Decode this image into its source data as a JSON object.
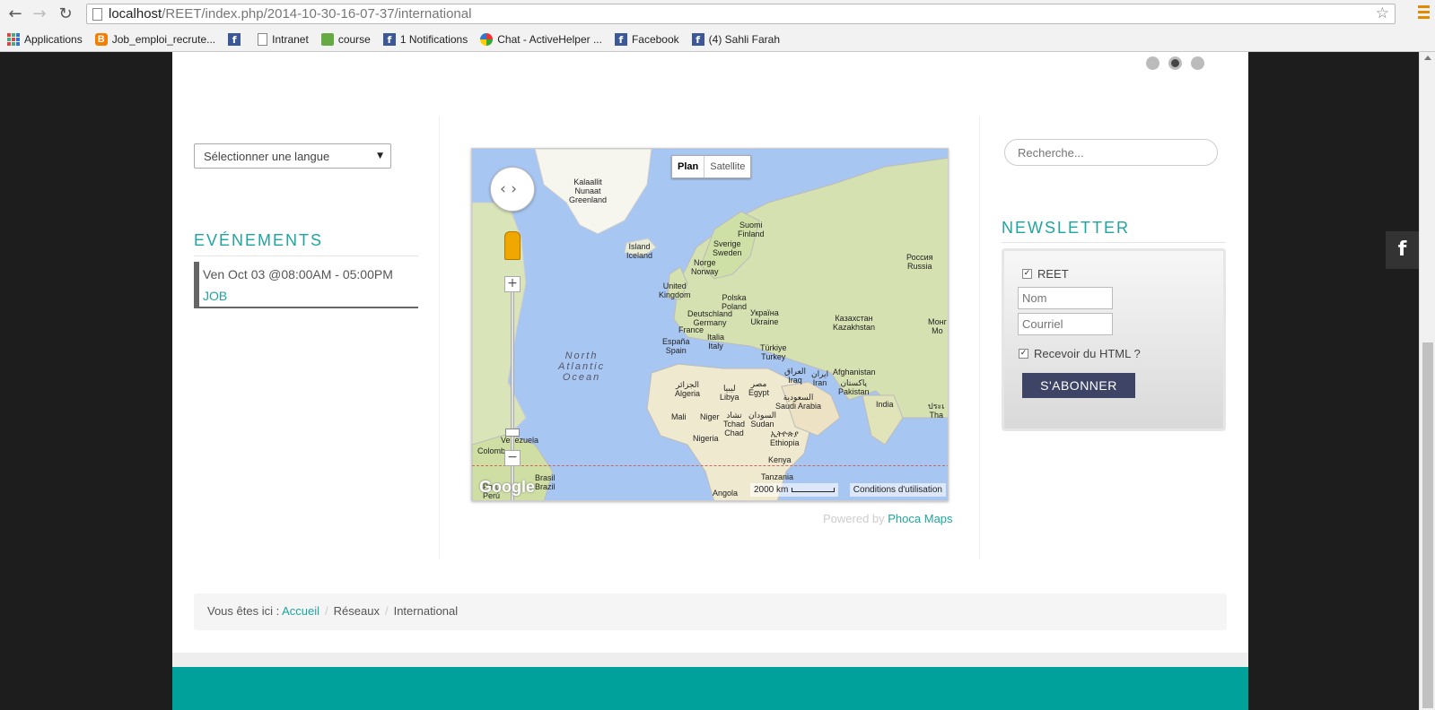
{
  "browser": {
    "url_host": "localhost",
    "url_path": "/REET/index.php/2014-10-30-16-07-37/international",
    "bookmarks": [
      {
        "label": "Applications",
        "icon": "apps-icon"
      },
      {
        "label": "Job_emploi_recrute...",
        "icon": "blogger-icon"
      },
      {
        "label": "",
        "icon": "facebook-icon"
      },
      {
        "label": "Intranet",
        "icon": "page-icon"
      },
      {
        "label": "course",
        "icon": "course-icon"
      },
      {
        "label": "1 Notifications",
        "icon": "facebook-icon"
      },
      {
        "label": "Chat - ActiveHelper ...",
        "icon": "chat-icon"
      },
      {
        "label": "Facebook",
        "icon": "facebook-icon"
      },
      {
        "label": "(4) Sahli Farah",
        "icon": "facebook-icon"
      }
    ]
  },
  "language_select": {
    "value": "Sélectionner une langue"
  },
  "events": {
    "title": "EVÉNEMENTS",
    "items": [
      {
        "date": "Ven Oct 03 @08:00AM - 05:00PM",
        "title": "JOB"
      }
    ]
  },
  "map": {
    "type_plan": "Plan",
    "type_satellite": "Satellite",
    "scale": "2000 km",
    "conditions": "Conditions d'utilisation",
    "logo": "Google",
    "ocean": "North\nAtlantic\nOcean",
    "labels": [
      {
        "text": "Kalaallit\nNunaat\nGreenland",
        "key": "greenland"
      },
      {
        "text": "Island\nIceland",
        "key": "iceland"
      },
      {
        "text": "Suomi\nFinland",
        "key": "finland"
      },
      {
        "text": "Sverige\nSweden",
        "key": "sweden"
      },
      {
        "text": "Norge\nNorway",
        "key": "norway"
      },
      {
        "text": "Россия\nRussia",
        "key": "russia"
      },
      {
        "text": "United\nKingdom",
        "key": "uk"
      },
      {
        "text": "Polska\nPoland",
        "key": "poland"
      },
      {
        "text": "Deutschland\nGermany",
        "key": "germany"
      },
      {
        "text": "Україна\nUkraine",
        "key": "ukraine"
      },
      {
        "text": "France",
        "key": "france"
      },
      {
        "text": "Казахстан\nKazakhstan",
        "key": "kazakhstan"
      },
      {
        "text": "España\nSpain",
        "key": "spain"
      },
      {
        "text": "Italia\nItaly",
        "key": "italy"
      },
      {
        "text": "Türkiye\nTurkey",
        "key": "turkey"
      },
      {
        "text": "Монг\nMo",
        "key": "mongolia"
      },
      {
        "text": "Afghanistan",
        "key": "afghanistan"
      },
      {
        "text": "العراق\nIraq",
        "key": "iraq"
      },
      {
        "text": "ایران\nIran",
        "key": "iran"
      },
      {
        "text": "پاکستان\nPakistan",
        "key": "pakistan"
      },
      {
        "text": "الجزائر\nAlgeria",
        "key": "algeria"
      },
      {
        "text": "ليبيا\nLibya",
        "key": "libya"
      },
      {
        "text": "مصر\nEgypt",
        "key": "egypt"
      },
      {
        "text": "السعودية\nSaudi Arabia",
        "key": "saudi"
      },
      {
        "text": "India",
        "key": "india"
      },
      {
        "text": "Mali",
        "key": "mali"
      },
      {
        "text": "Niger",
        "key": "niger"
      },
      {
        "text": "تشاد\nTchad\nChad",
        "key": "chad"
      },
      {
        "text": "السودان\nSudan",
        "key": "sudan"
      },
      {
        "text": "Nigeria",
        "key": "nigeria"
      },
      {
        "text": "ኢትዮጵያ\nEthiopia",
        "key": "ethiopia"
      },
      {
        "text": "Venezuela",
        "key": "venezuela"
      },
      {
        "text": "Colomb",
        "key": "colombia"
      },
      {
        "text": "Kenya",
        "key": "kenya"
      },
      {
        "text": "Tanzania",
        "key": "tanzania"
      },
      {
        "text": "Brasil\nBrazil",
        "key": "brazil"
      },
      {
        "text": "Peru\nPerú",
        "key": "peru"
      },
      {
        "text": "Angola",
        "key": "angola"
      },
      {
        "text": "ประเ\nTha",
        "key": "thailand"
      }
    ]
  },
  "powered": {
    "prefix": "Powered by ",
    "link": "Phoca Maps"
  },
  "search": {
    "placeholder": "Recherche..."
  },
  "newsletter": {
    "title": "NEWSLETTER",
    "list_label": "REET",
    "name_placeholder": "Nom",
    "email_placeholder": "Courriel",
    "html_label": "Recevoir du HTML ?",
    "subscribe_label": "S'ABONNER"
  },
  "breadcrumb": {
    "prefix": "Vous êtes ici : ",
    "items": [
      "Accueil",
      "Réseaux",
      "International"
    ]
  },
  "social": {
    "facebook_label": "f"
  }
}
